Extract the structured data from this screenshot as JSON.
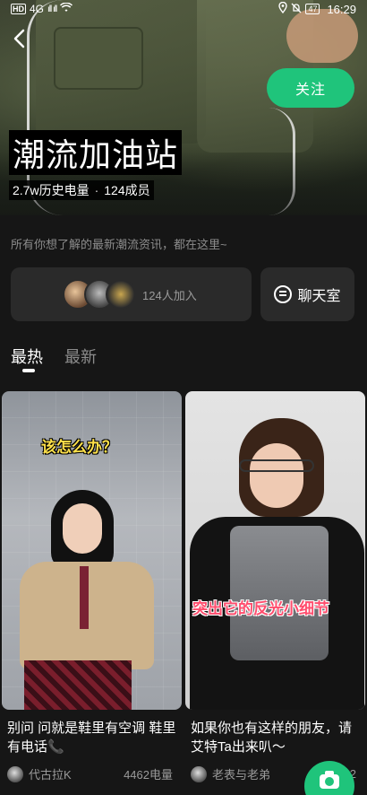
{
  "status_bar": {
    "hd_label": "HD",
    "network": "4G",
    "signal": "ıll ıll",
    "wifi_icon": "wifi-icon",
    "battery": "47",
    "time": "16:29"
  },
  "header": {
    "follow_label": "关注",
    "group_title": "潮流加油站",
    "history_power": "2.7w历史电量",
    "separator": "·",
    "members": "124成员"
  },
  "description": "所有你想了解的最新潮流资讯，都在这里~",
  "join_card": {
    "joined_text": "124人加入"
  },
  "chat_room_label": "聊天室",
  "tabs": [
    {
      "label": "最热",
      "active": true
    },
    {
      "label": "最新",
      "active": false
    }
  ],
  "posts": [
    {
      "overlay_caption": "该怎么办？",
      "title": "别问 问就是鞋里有空调 鞋里有电话📞",
      "user": "代古拉K",
      "heat": "4462电量"
    },
    {
      "overlay_caption": "突出它的反光小细节",
      "title": "如果你也有这样的朋友，请艾特Ta出来叭～",
      "user": "老表与老弟",
      "heat": "2"
    }
  ],
  "colors": {
    "accent_green": "#1fc47b",
    "background": "#161616",
    "card_bg": "#2a2a2a"
  }
}
